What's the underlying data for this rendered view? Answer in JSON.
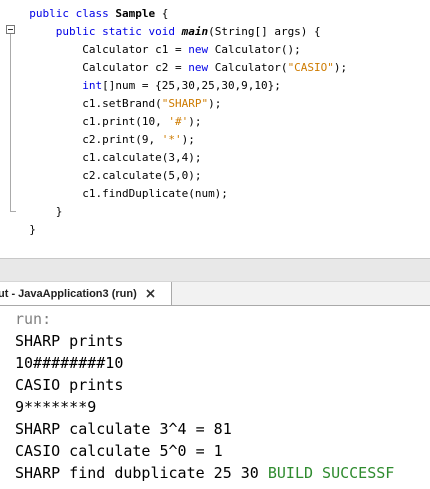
{
  "editor": {
    "lines": [
      {
        "indent": "  ",
        "parts": [
          {
            "t": "kw",
            "v": "public class "
          },
          {
            "t": "cls",
            "v": "Sample"
          },
          {
            "t": "",
            "v": " {"
          }
        ]
      },
      {
        "indent": "      ",
        "parts": [
          {
            "t": "kw",
            "v": "public static void "
          },
          {
            "t": "mdef",
            "v": "main"
          },
          {
            "t": "",
            "v": "(String[] args) {"
          }
        ]
      },
      {
        "indent": "          ",
        "parts": [
          {
            "t": "",
            "v": "Calculator c1 = "
          },
          {
            "t": "kw",
            "v": "new"
          },
          {
            "t": "",
            "v": " Calculator();"
          }
        ]
      },
      {
        "indent": "          ",
        "parts": [
          {
            "t": "",
            "v": "Calculator c2 = "
          },
          {
            "t": "kw",
            "v": "new"
          },
          {
            "t": "",
            "v": " Calculator("
          },
          {
            "t": "str",
            "v": "\"CASIO\""
          },
          {
            "t": "",
            "v": ");"
          }
        ]
      },
      {
        "indent": "          ",
        "parts": [
          {
            "t": "kw",
            "v": "int"
          },
          {
            "t": "",
            "v": "[]num = {25,30,25,30,9,10};"
          }
        ]
      },
      {
        "indent": "          ",
        "parts": [
          {
            "t": "",
            "v": "c1.setBrand("
          },
          {
            "t": "str",
            "v": "\"SHARP\""
          },
          {
            "t": "",
            "v": ");"
          }
        ]
      },
      {
        "indent": "          ",
        "parts": [
          {
            "t": "",
            "v": "c1.print(10, "
          },
          {
            "t": "str",
            "v": "'#'"
          },
          {
            "t": "",
            "v": ");"
          }
        ]
      },
      {
        "indent": "          ",
        "parts": [
          {
            "t": "",
            "v": "c2.print(9, "
          },
          {
            "t": "str",
            "v": "'*'"
          },
          {
            "t": "",
            "v": ");"
          }
        ]
      },
      {
        "indent": "          ",
        "parts": [
          {
            "t": "",
            "v": "c1.calculate(3,4);"
          }
        ]
      },
      {
        "indent": "          ",
        "parts": [
          {
            "t": "",
            "v": "c2.calculate(5,0);"
          }
        ]
      },
      {
        "indent": "          ",
        "parts": [
          {
            "t": "",
            "v": "c1.findDuplicate(num);"
          }
        ]
      },
      {
        "indent": "      ",
        "parts": [
          {
            "t": "",
            "v": "}"
          }
        ]
      },
      {
        "indent": "  ",
        "parts": [
          {
            "t": "",
            "v": "}"
          }
        ]
      }
    ]
  },
  "output_tab": {
    "title": "ut - JavaApplication3 (run)",
    "close_icon": "close-icon"
  },
  "console": {
    "run_label": "run:",
    "lines": [
      "SHARP prints",
      "10########10",
      "CASIO prints",
      "9*******9",
      "SHARP calculate 3^4 = 81",
      "CASIO calculate 5^0 = 1"
    ],
    "last_line_prefix": "SHARP find dubplicate 25 30 ",
    "build_status": "BUILD SUCCESSF"
  },
  "colors": {
    "keyword": "#0000e6",
    "string": "#ce7b00",
    "run_text": "#808080",
    "build_success": "#2e8b2e"
  }
}
